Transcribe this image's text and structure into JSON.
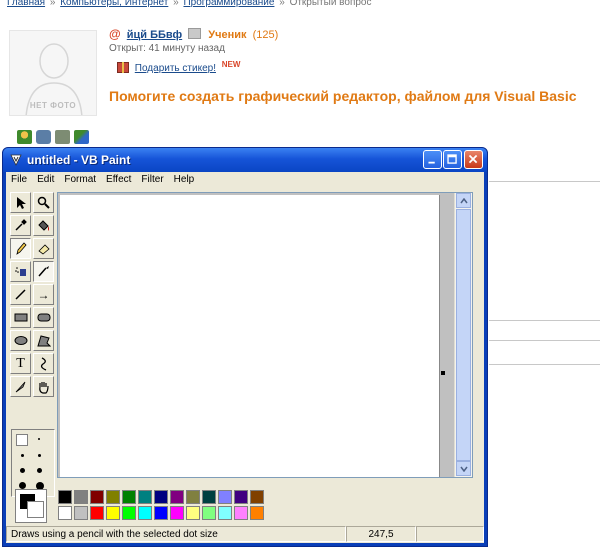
{
  "breadcrumb": {
    "items": [
      "Главная",
      "Компьютеры, Интернет",
      "Программирование"
    ],
    "current": "Открытый вопрос",
    "separator": "»"
  },
  "avatar": {
    "placeholder_text": "НЕТ ФОТО"
  },
  "user": {
    "name": "йцй ББвф",
    "rank": "Ученик",
    "rank_count": "(125)"
  },
  "question": {
    "opened": "Открыт: 41 минуту назад",
    "gift_label": "Подарить стикер!",
    "gift_badge": "NEW",
    "title": "Помогите создать графический редактор, файлом для Visual Basic"
  },
  "window": {
    "title": "untitled - VB Paint",
    "menu": [
      "File",
      "Edit",
      "Format",
      "Effect",
      "Filter",
      "Help"
    ],
    "tool_glyphs": {
      "text": "T",
      "line": "/",
      "arrow": "→",
      "curve": "≀"
    },
    "palette_top": [
      "#000000",
      "#808080",
      "#800000",
      "#808000",
      "#008000",
      "#008080",
      "#000080",
      "#800080",
      "#808040",
      "#004040",
      "#8080ff",
      "#400080",
      "#804000"
    ],
    "palette_bottom": [
      "#ffffff",
      "#c0c0c0",
      "#ff0000",
      "#ffff00",
      "#00ff00",
      "#00ffff",
      "#0000ff",
      "#ff00ff",
      "#ffff80",
      "#80ff80",
      "#80ffff",
      "#ff80ff",
      "#ff8000"
    ],
    "status": {
      "hint": "Draws using a pencil with the selected dot size",
      "coords": "247,5"
    }
  }
}
